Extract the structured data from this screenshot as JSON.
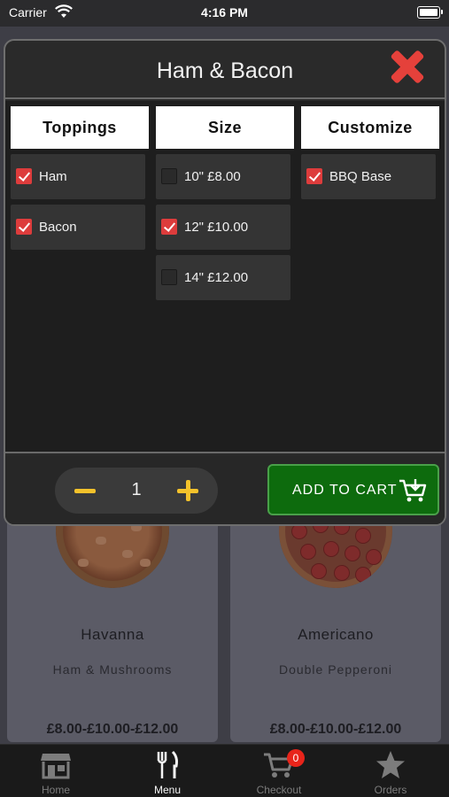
{
  "status_bar": {
    "carrier": "Carrier",
    "time": "4:16 PM",
    "wifi_icon": "wifi-icon",
    "battery_icon": "battery-icon"
  },
  "modal": {
    "title": "Ham & Bacon",
    "close_icon": "close-icon",
    "columns": {
      "toppings": {
        "header": "Toppings",
        "options": [
          {
            "label": "Ham",
            "checked": true
          },
          {
            "label": "Bacon",
            "checked": true
          }
        ]
      },
      "size": {
        "header": "Size",
        "options": [
          {
            "label": "10\" £8.00",
            "checked": false
          },
          {
            "label": "12\" £10.00",
            "checked": true
          },
          {
            "label": "14\" £12.00",
            "checked": false
          }
        ]
      },
      "customize": {
        "header": "Customize",
        "options": [
          {
            "label": "BBQ Base",
            "checked": true
          }
        ]
      }
    },
    "quantity": {
      "value": "1",
      "minus_icon": "minus-icon",
      "plus_icon": "plus-icon"
    },
    "add_to_cart": {
      "label": "ADD TO CART",
      "icon": "cart-download-icon"
    }
  },
  "menu": {
    "items": [
      {
        "name": "Havanna",
        "description": "Ham & Mushrooms",
        "price": "£8.00-£10.00-£12.00"
      },
      {
        "name": "Americano",
        "description": "Double Pepperoni",
        "price": "£8.00-£10.00-£12.00"
      }
    ]
  },
  "tab_bar": {
    "tabs": [
      {
        "label": "Home",
        "icon": "store-icon",
        "active": false
      },
      {
        "label": "Menu",
        "icon": "fork-knife-icon",
        "active": true
      },
      {
        "label": "Checkout",
        "icon": "cart-icon",
        "active": false,
        "badge": "0"
      },
      {
        "label": "Orders",
        "icon": "star-icon",
        "active": false
      }
    ]
  },
  "colors": {
    "accent_red": "#dd3c3c",
    "close_red": "#e5413b",
    "qty_yellow": "#f4c22b",
    "cart_green": "#0d6b0d",
    "badge_red": "#e8241a"
  }
}
